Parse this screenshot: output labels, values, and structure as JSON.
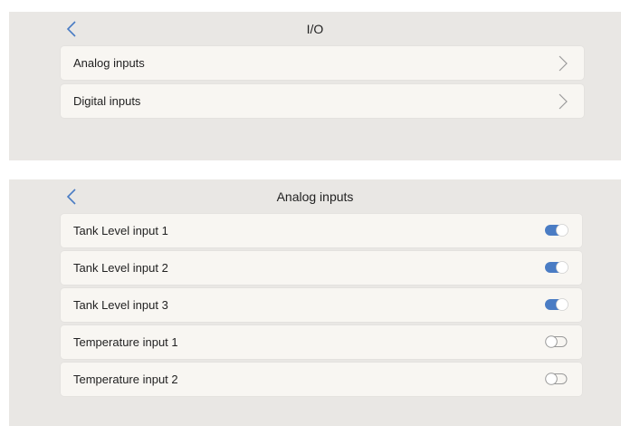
{
  "io_screen": {
    "title": "I/O",
    "items": [
      {
        "label": "Analog inputs"
      },
      {
        "label": "Digital inputs"
      }
    ]
  },
  "analog_screen": {
    "title": "Analog inputs",
    "items": [
      {
        "label": "Tank Level input 1",
        "enabled": true
      },
      {
        "label": "Tank Level input 2",
        "enabled": true
      },
      {
        "label": "Tank Level input 3",
        "enabled": true
      },
      {
        "label": "Temperature input 1",
        "enabled": false
      },
      {
        "label": "Temperature input 2",
        "enabled": false
      }
    ]
  },
  "colors": {
    "accent": "#4a7cc4",
    "panel_bg": "#e9e7e4",
    "row_bg": "#f8f6f2"
  },
  "icons": {
    "back": "chevron-left-icon",
    "forward": "chevron-right-icon",
    "toggle_on": "toggle-on-icon",
    "toggle_off": "toggle-off-icon"
  }
}
